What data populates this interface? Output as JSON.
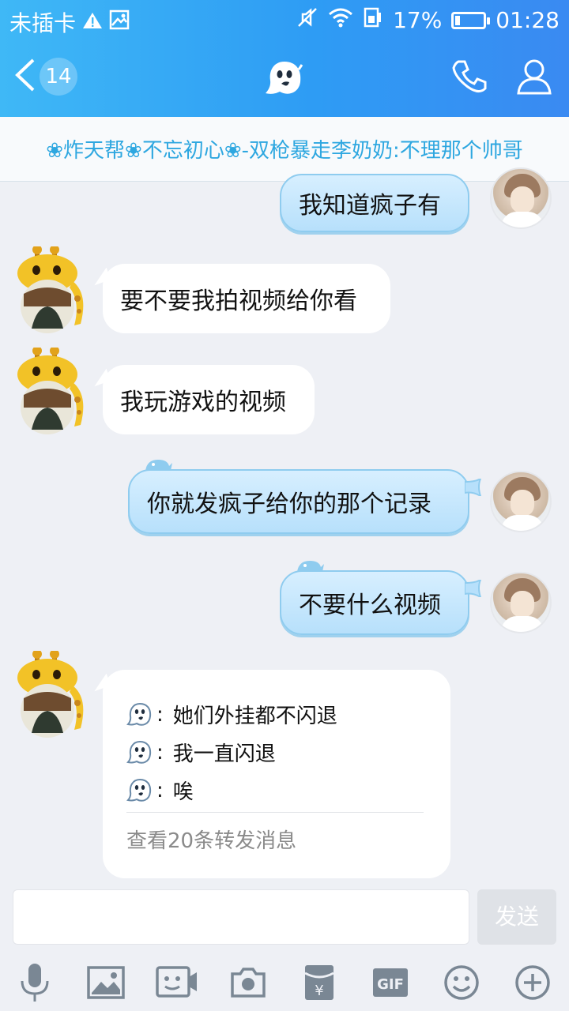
{
  "status_bar": {
    "carrier": "未插卡",
    "battery_text": "17%",
    "battery_level": 0.17,
    "time": "01:28"
  },
  "header": {
    "unread_count": "14",
    "group_name": "❀炸天帮❀不忘初心❀-双枪暴走李奶奶:不理那个帅哥"
  },
  "messages": [
    {
      "side": "out",
      "text": "我知道疯子有"
    },
    {
      "side": "in",
      "text": "要不要我拍视频给你看"
    },
    {
      "side": "in",
      "text": "我玩游戏的视频"
    },
    {
      "side": "out",
      "text": "你就发疯子给你的那个记录"
    },
    {
      "side": "out",
      "text": "不要什么视频"
    }
  ],
  "forward_card": {
    "lines": [
      {
        "sep": ":",
        "text": "她们外挂都不闪退"
      },
      {
        "sep": ":",
        "text": "我一直闪退"
      },
      {
        "sep": ":",
        "text": "唉"
      }
    ],
    "link_text": "查看20条转发消息"
  },
  "input": {
    "placeholder": "",
    "send_label": "发送"
  },
  "toolbar": {
    "gif_label": "GIF",
    "items": [
      "mic-icon",
      "image-icon",
      "video-icon",
      "camera-icon",
      "red-packet-icon",
      "gif-icon",
      "emoji-icon",
      "plus-icon"
    ]
  },
  "colors": {
    "accent": "#2e9cf4",
    "banner_text": "#2ea7e0",
    "bubble_out": "#c4e6fc"
  }
}
